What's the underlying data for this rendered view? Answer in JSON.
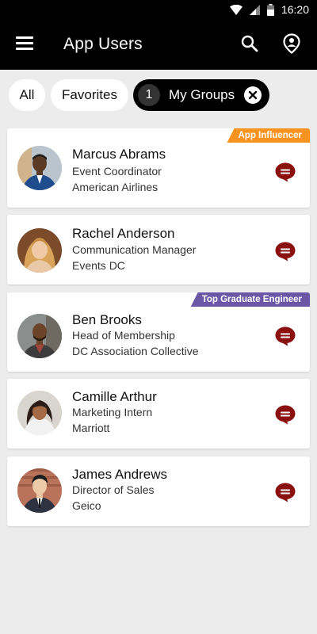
{
  "status_bar": {
    "time": "16:20"
  },
  "app_bar": {
    "title": "App Users"
  },
  "filters": {
    "all_label": "All",
    "favorites_label": "Favorites",
    "groups_count": "1",
    "groups_label": "My Groups"
  },
  "colors": {
    "badge_orange": "#f7931e",
    "badge_purple": "#6b57a5",
    "chat_red": "#8b1111"
  },
  "users": [
    {
      "name": "Marcus Abrams",
      "title": "Event Coordinator",
      "company": "American Airlines",
      "badge": "App Influencer"
    },
    {
      "name": "Rachel Anderson",
      "title": "Communication Manager",
      "company": "Events DC"
    },
    {
      "name": "Ben Brooks",
      "title": "Head of Membership",
      "company": "DC Association Collective",
      "badge": "Top Graduate Engineer"
    },
    {
      "name": "Camille Arthur",
      "title": "Marketing Intern",
      "company": "Marriott"
    },
    {
      "name": "James Andrews",
      "title": "Director of Sales",
      "company": "Geico"
    }
  ]
}
